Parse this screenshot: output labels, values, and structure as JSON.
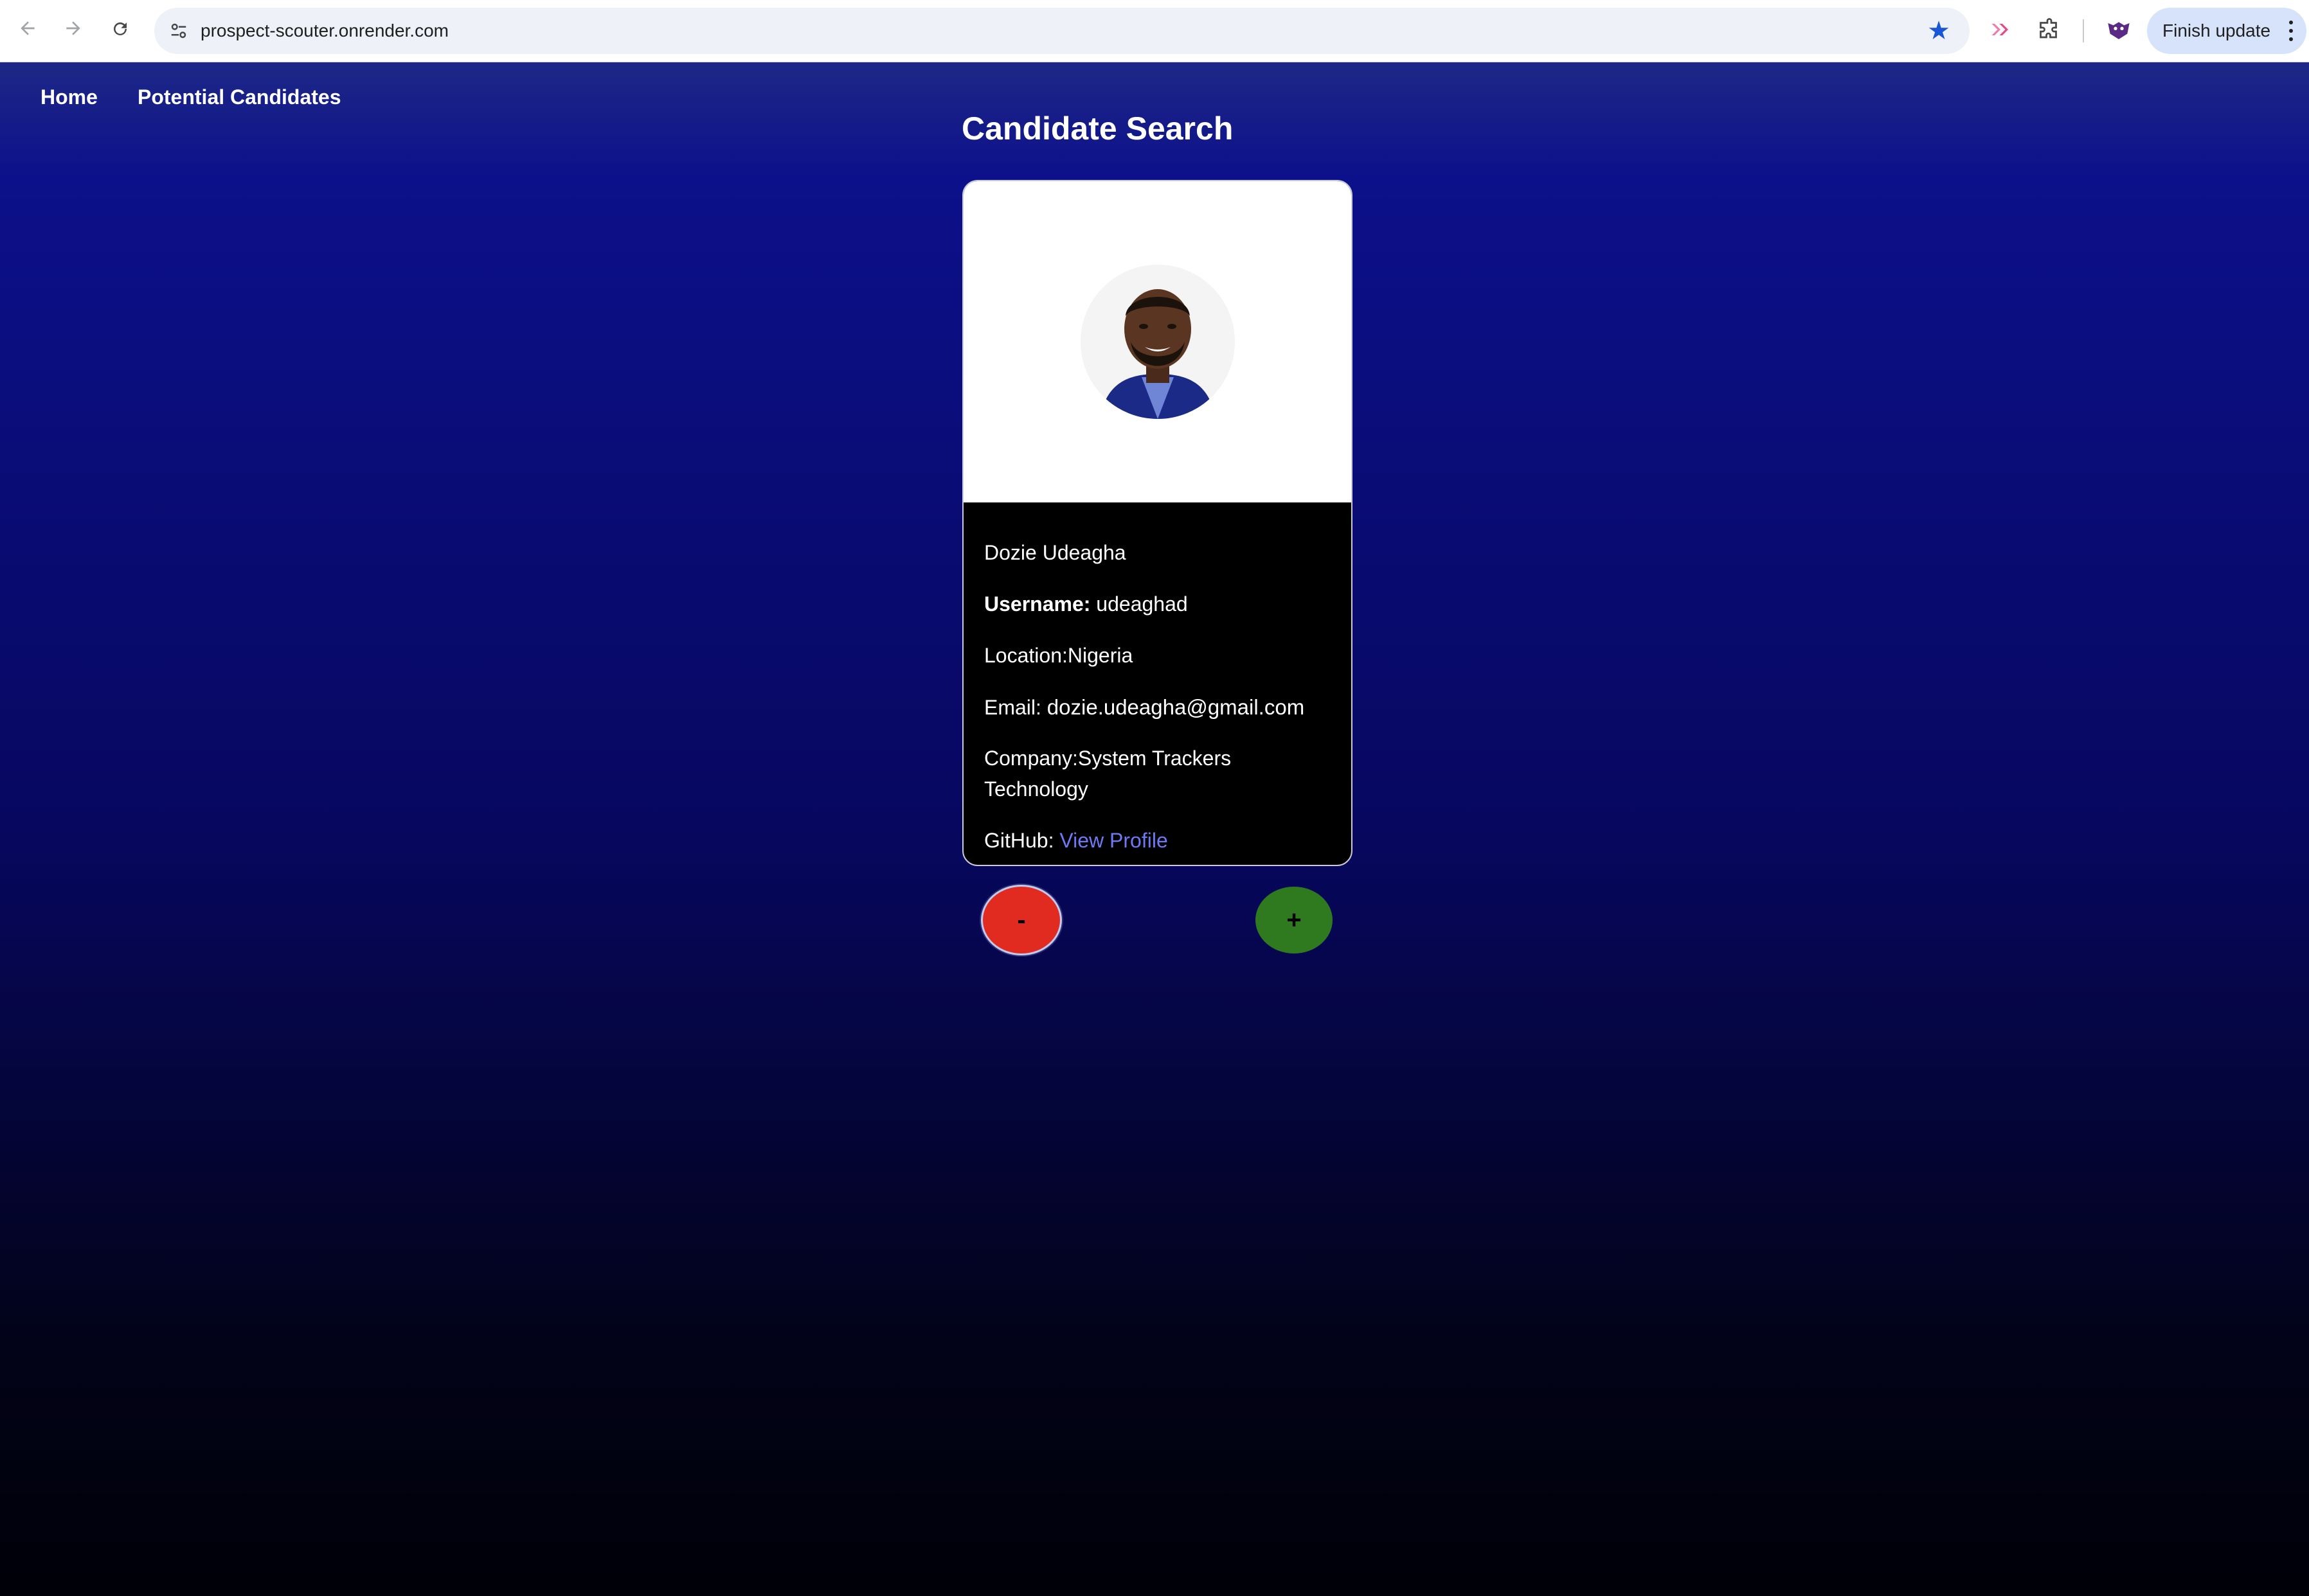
{
  "browser": {
    "url": "prospect-scouter.onrender.com",
    "update_button_label": "Finish update",
    "icons": {
      "back": "arrow-left-icon",
      "forward": "arrow-right-icon",
      "reload": "reload-icon",
      "site_info": "tune-icon",
      "bookmark": "star-icon",
      "extension_1": "send-arrow-icon",
      "extensions": "puzzle-icon",
      "profile": "profile-avatar-icon",
      "menu": "kebab-menu-icon"
    },
    "colors": {
      "bookmark": "#1a57d6",
      "update_button_bg": "#d7e2fb"
    }
  },
  "nav": {
    "items": [
      {
        "label": "Home"
      },
      {
        "label": "Potential Candidates"
      }
    ]
  },
  "page": {
    "title": "Candidate Search"
  },
  "candidate": {
    "name": "Dozie Udeagha",
    "username_label": "Username:",
    "username": "udeaghad",
    "location_text": "Location:Nigeria",
    "email_label": "Email:",
    "email": "dozie.udeagha@gmail.com",
    "company_line1": "Company:System Trackers",
    "company_line2": "Technology",
    "github_label": "GitHub:",
    "github_link": "View Profile"
  },
  "actions": {
    "reject_label": "-",
    "accept_label": "+",
    "colors": {
      "reject": "#e12b20",
      "accept": "#2f7a1f",
      "link": "#6e79f4"
    }
  }
}
